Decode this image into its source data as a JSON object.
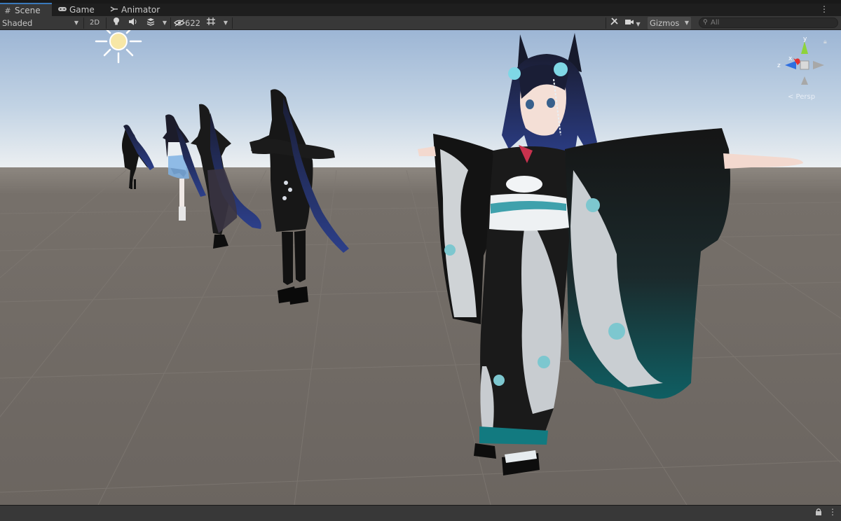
{
  "tabs": [
    {
      "label": "Scene",
      "icon": "grid-icon",
      "active": true
    },
    {
      "label": "Game",
      "icon": "gamepad-icon",
      "active": false
    },
    {
      "label": "Animator",
      "icon": "animator-icon",
      "active": false
    }
  ],
  "toolbar": {
    "shading_mode": "Shaded",
    "mode_2d_label": "2D",
    "hidden_count": "622",
    "gizmos_label": "Gizmos",
    "search_placeholder": "All"
  },
  "gizmo": {
    "x_label": "x",
    "y_label": "y",
    "z_label": "z",
    "projection_label": "< Persp"
  },
  "colors": {
    "tab_active_accent": "#3a79bb",
    "toolbar_bg": "#383838",
    "sky_top": "#9fb7d6",
    "horizon": "#e6ebef",
    "ground": "#6e6862",
    "axis_x": "#e53030",
    "axis_y": "#8ed33b",
    "axis_z": "#2f6fe0"
  }
}
